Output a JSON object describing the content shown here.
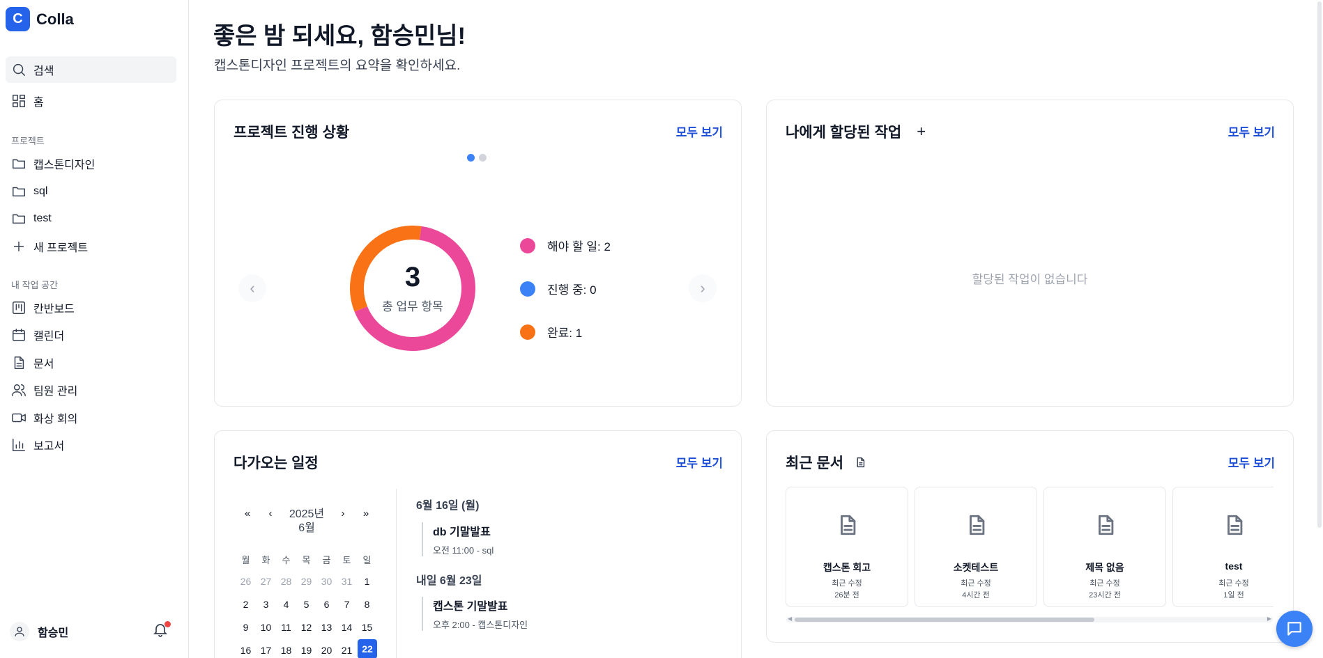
{
  "app": {
    "logo_letter": "C",
    "name": "Colla"
  },
  "sidebar": {
    "search_label": "검색",
    "home_label": "홈",
    "projects_heading": "프로젝트",
    "projects": [
      {
        "label": "캡스톤디자인"
      },
      {
        "label": "sql"
      },
      {
        "label": "test"
      }
    ],
    "new_project_label": "새 프로젝트",
    "workspace_heading": "내 작업 공간",
    "workspace_items": [
      {
        "label": "칸반보드",
        "icon": "kanban-icon"
      },
      {
        "label": "캘린더",
        "icon": "calendar-icon"
      },
      {
        "label": "문서",
        "icon": "document-icon"
      },
      {
        "label": "팀원 관리",
        "icon": "users-icon"
      },
      {
        "label": "화상 회의",
        "icon": "video-icon"
      },
      {
        "label": "보고서",
        "icon": "bar-chart-icon"
      }
    ],
    "user_name": "함승민"
  },
  "header": {
    "greeting": "좋은 밤 되세요, 함승민님!",
    "subtitle": "캡스톤디자인 프로젝트의 요약을 확인하세요."
  },
  "progress_card": {
    "title": "프로젝트 진행 상황",
    "view_all": "모두 보기",
    "total": "3",
    "total_label": "총 업무 항목",
    "legend": [
      {
        "label": "해야 할 일: 2",
        "color": "#ec4899"
      },
      {
        "label": "진행 중: 0",
        "color": "#3b82f6"
      },
      {
        "label": "완료: 1",
        "color": "#f97316"
      }
    ]
  },
  "chart_data": {
    "type": "pie",
    "categories": [
      "해야 할 일",
      "진행 중",
      "완료"
    ],
    "values": [
      2,
      0,
      1
    ],
    "colors": [
      "#ec4899",
      "#3b82f6",
      "#f97316"
    ],
    "title": "",
    "center_value": 3,
    "center_label": "총 업무 항목"
  },
  "assigned_card": {
    "title": "나에게 할당된 작업",
    "add_symbol": "+",
    "view_all": "모두 보기",
    "empty_message": "할당된 작업이 없습니다"
  },
  "schedule_card": {
    "title": "다가오는 일정",
    "view_all": "모두 보기",
    "calendar": {
      "nav_prev_year": "«",
      "nav_prev_month": "‹",
      "nav_next_month": "›",
      "nav_next_year": "»",
      "year_label": "2025년",
      "month_label": "6월",
      "weekdays": [
        "월",
        "화",
        "수",
        "목",
        "금",
        "토",
        "일"
      ],
      "rows": [
        [
          "26",
          "27",
          "28",
          "29",
          "30",
          "31",
          "1"
        ],
        [
          "2",
          "3",
          "4",
          "5",
          "6",
          "7",
          "8"
        ],
        [
          "9",
          "10",
          "11",
          "12",
          "13",
          "14",
          "15"
        ],
        [
          "16",
          "17",
          "18",
          "19",
          "20",
          "21",
          "22"
        ]
      ],
      "today": "22"
    },
    "events": [
      {
        "date": "6월 16일 (월)",
        "title": "db 기말발표",
        "meta": "오전 11:00 - sql"
      },
      {
        "date": "내일 6월 23일",
        "title": "캡스톤 기말발표",
        "meta": "오후 2:00 - 캡스톤디자인"
      }
    ]
  },
  "docs_card": {
    "title": "최근 문서",
    "view_all": "모두 보기",
    "modified_label": "최근 수정",
    "docs": [
      {
        "name": "캡스톤 회고",
        "modified_label": "최근 수정",
        "ago": "26분 전"
      },
      {
        "name": "소켓테스트",
        "modified_label": "최근 수정",
        "ago": "4시간 전"
      },
      {
        "name": "제목 없음",
        "modified_label": "최근 수정",
        "ago": "23시간 전"
      },
      {
        "name": "test",
        "modified_label": "최근 수정",
        "ago": "1일 전"
      }
    ]
  },
  "colors": {
    "accent": "#2563eb",
    "link": "#1d4ed8"
  }
}
